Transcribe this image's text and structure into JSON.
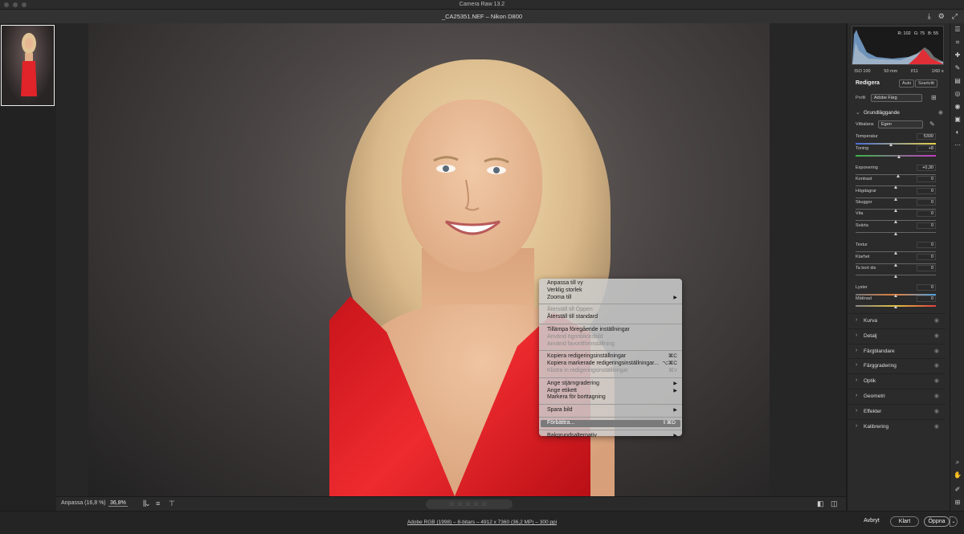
{
  "window": {
    "title": "Camera Raw 13.2"
  },
  "document": {
    "name": "_CA25351.NEF",
    "camera": "Nikon D800",
    "separator": "–"
  },
  "context_menu": {
    "items": [
      {
        "label": "Anpassa till vy",
        "disabled": false
      },
      {
        "label": "Verklig storlek",
        "disabled": false
      },
      {
        "label": "Zooma till",
        "disabled": false,
        "submenu": true
      },
      {
        "sep": true
      },
      {
        "label": "Återställ till Öppen",
        "disabled": true
      },
      {
        "label": "Återställ till standard",
        "disabled": false
      },
      {
        "sep": true
      },
      {
        "label": "Tillämpa föregående inställningar",
        "disabled": false
      },
      {
        "label": "Använd ögonblicksbild",
        "disabled": true
      },
      {
        "label": "Använd favoritförinställning",
        "disabled": true
      },
      {
        "sep": true
      },
      {
        "label": "Kopiera redigeringsinställningar",
        "disabled": false,
        "shortcut": "⌘C"
      },
      {
        "label": "Kopiera markerade redigeringsinställningar...",
        "disabled": false,
        "shortcut": "⌥⌘C"
      },
      {
        "label": "Klistra in redigeringsinställningar",
        "disabled": true,
        "shortcut": "⌘V"
      },
      {
        "sep": true
      },
      {
        "label": "Ange stjärngradering",
        "disabled": false,
        "submenu": true
      },
      {
        "label": "Ange etikett",
        "disabled": false,
        "submenu": true
      },
      {
        "label": "Markera för borttagning",
        "disabled": false
      },
      {
        "sep": true
      },
      {
        "label": "Spara bild",
        "disabled": false,
        "submenu": true
      },
      {
        "sep": true
      },
      {
        "label": "Förbättra...",
        "disabled": false,
        "shortcut": "⇧⌘D",
        "highlighted": true
      },
      {
        "sep": true
      },
      {
        "label": "Bakgrundsalternativ",
        "disabled": false,
        "submenu": true
      }
    ]
  },
  "bottom_tools": {
    "fit_label": "Anpassa (16,8 %)",
    "zoom_value": "36,8%",
    "stars": "☆☆☆☆☆"
  },
  "status_info": "Adobe RGB (1998) – 8-bitars – 4912 x 7360 (36,2 MP) – 300 ppi",
  "buttons": {
    "cancel": "Avbryt",
    "done": "Klart",
    "open": "Öppna"
  },
  "histogram": {
    "r": "R: 102",
    "g": "G: 75",
    "b": "B: 55"
  },
  "exif": {
    "iso": "ISO 100",
    "focal": "50 mm",
    "aperture": "f/11",
    "shutter": "1/60 s"
  },
  "edit": {
    "title": "Redigera",
    "auto": "Auto",
    "bw": "Svartvitt",
    "profile_label": "Profil",
    "profile_value": "Adobe Färg",
    "basic_title": "Grundläggande",
    "wb_label": "Vitbalans",
    "wb_value": "Egen",
    "sliders": [
      {
        "label": "Temperatur",
        "value": "5300",
        "pos": 0.44
      },
      {
        "label": "Toning",
        "value": "+8",
        "pos": 0.54
      },
      {
        "label": "Exponering",
        "value": "+0,30",
        "pos": 0.53
      },
      {
        "label": "Kontrast",
        "value": "0",
        "pos": 0.5
      },
      {
        "label": "Högdagrar",
        "value": "0",
        "pos": 0.5
      },
      {
        "label": "Skuggor",
        "value": "0",
        "pos": 0.5
      },
      {
        "label": "Vita",
        "value": "0",
        "pos": 0.5
      },
      {
        "label": "Svärta",
        "value": "0",
        "pos": 0.5
      },
      {
        "label": "Textur",
        "value": "0",
        "pos": 0.5
      },
      {
        "label": "Klarhet",
        "value": "0",
        "pos": 0.5
      },
      {
        "label": "Ta bort dis",
        "value": "0",
        "pos": 0.5
      },
      {
        "label": "Lyster",
        "value": "0",
        "pos": 0.5
      },
      {
        "label": "Mättnad",
        "value": "0",
        "pos": 0.5
      }
    ],
    "panels": [
      "Kurva",
      "Detalj",
      "Färgblandare",
      "Färggradering",
      "Optik",
      "Geometri",
      "Effekter",
      "Kalibrering"
    ]
  },
  "colors": {
    "accent": "#1473e6",
    "menu_highlight": "#7a7a7a",
    "dress_red": "#e02026"
  }
}
